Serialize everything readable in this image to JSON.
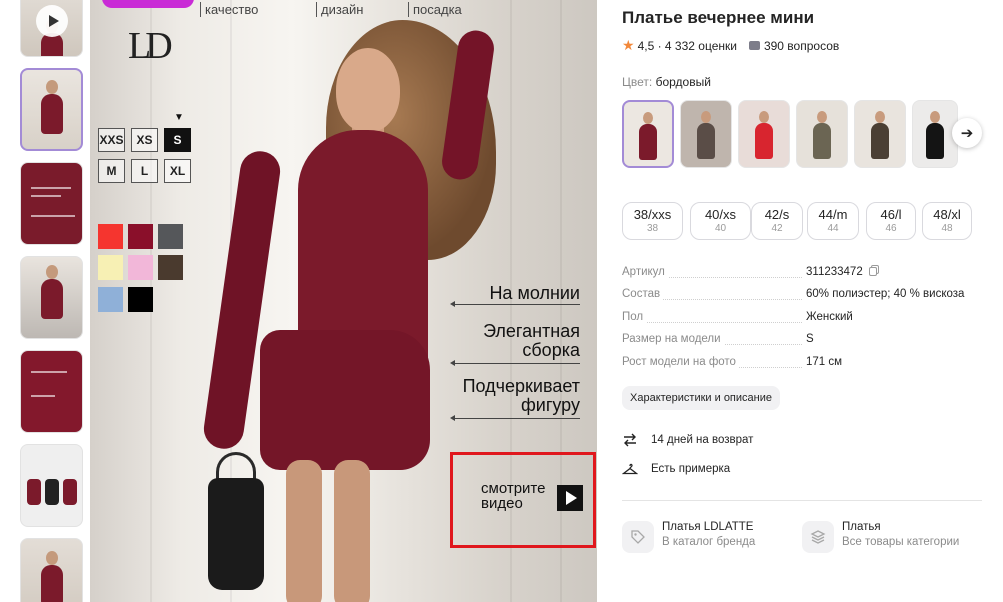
{
  "product": {
    "title": "Платье вечернее мини",
    "rating": "4,5",
    "ratings_count": "4 332 оценки",
    "questions": "390 вопросов",
    "color_label": "Цвет:",
    "color_value": "бордовый"
  },
  "image_overlay": {
    "top_features": [
      "качество",
      "дизайн",
      "посадка"
    ],
    "logo_text": "LD",
    "sizes": [
      "XXS",
      "XS",
      "S",
      "M",
      "L",
      "XL"
    ],
    "selected_size": "S",
    "selected_marker": "▼",
    "swatch_colors": [
      "#f5352f",
      "#8a0f2a",
      "#55575a",
      "#f7f0b4",
      "#f2b7d9",
      "#4a3a2e",
      "#8fb0d8",
      "#000000"
    ],
    "features": {
      "f1_line1": "На молнии",
      "f2_line1": "Элегантная",
      "f2_line2": "сборка",
      "f3_line1": "Подчеркивает",
      "f3_line2": "фигуру"
    },
    "video_line1": "смотрите",
    "video_line2": "видео"
  },
  "variants": [
    {
      "color": "#7b1a2b",
      "bg": "#ece7e1"
    },
    {
      "color": "#5a4d47",
      "bg": "#bfb5ad"
    },
    {
      "color": "#d8252f",
      "bg": "#e8dcd8"
    },
    {
      "color": "#6b6553",
      "bg": "#e6e1da"
    },
    {
      "color": "#4a3f34",
      "bg": "#e9e4de"
    },
    {
      "color": "#141414",
      "bg": "#ecebea"
    }
  ],
  "sizes": [
    {
      "label": "38/xxs",
      "ru": "38"
    },
    {
      "label": "40/xs",
      "ru": "40"
    },
    {
      "label": "42/s",
      "ru": "42"
    },
    {
      "label": "44/m",
      "ru": "44"
    },
    {
      "label": "46/l",
      "ru": "46"
    },
    {
      "label": "48/xl",
      "ru": "48"
    }
  ],
  "specs": [
    {
      "key": "Артикул",
      "value": "311233472"
    },
    {
      "key": "Состав",
      "value": "60% полиэстер; 40 % вискоза"
    },
    {
      "key": "Пол",
      "value": "Женский"
    },
    {
      "key": "Размер на модели",
      "value": "S"
    },
    {
      "key": "Рост модели на фото",
      "value": "171 см"
    }
  ],
  "characteristics_button": "Характеристики и описание",
  "returns_text": "14 дней на возврат",
  "fitting_text": "Есть примерка",
  "brand_card": {
    "title": "Платья LDLATTE",
    "subtitle": "В каталог бренда"
  },
  "category_card": {
    "title": "Платья",
    "subtitle": "Все товары категории"
  },
  "colors": {
    "accent_purple": "#a38bd6",
    "star": "#f2883a",
    "video_frame": "#e0171d"
  }
}
